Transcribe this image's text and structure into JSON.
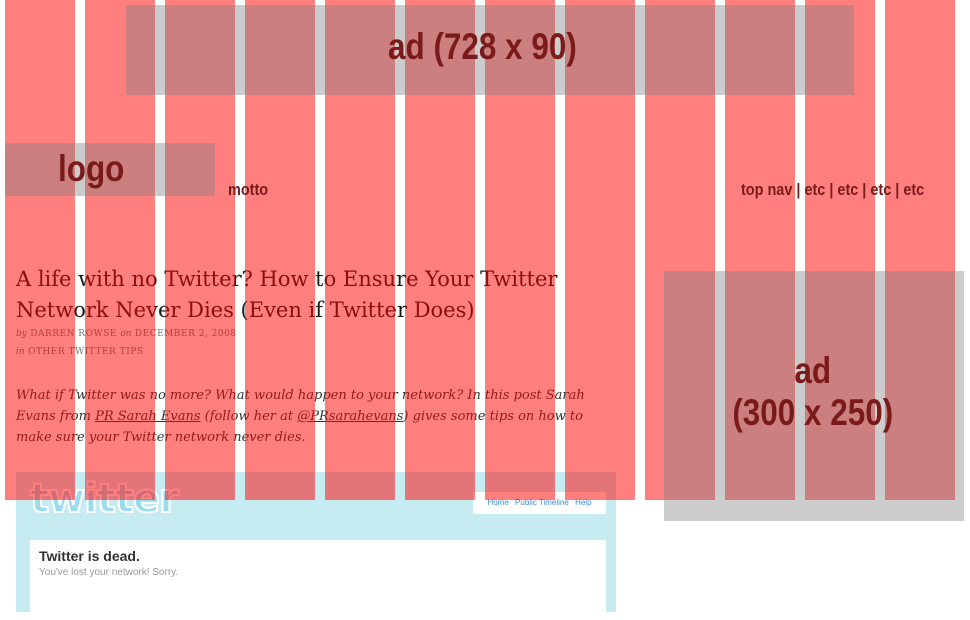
{
  "wireframe": {
    "top_ad_label": "ad (728 x 90)",
    "logo_label": "logo",
    "motto_label": "motto",
    "top_nav_label": "top nav | etc | etc | etc | etc",
    "side_ad_label": "ad\n(300 x 250)",
    "column_color": "#ff0000",
    "box_color": "#808080"
  },
  "post": {
    "title": "A life with no Twitter? How to Ensure Your Twitter Network Never Dies (Even if Twitter Does)",
    "by_prefix": "by",
    "author": "Darren Rowse",
    "on_prefix": "on",
    "date": "December 2, 2008",
    "in_prefix": "in",
    "category": "Other Twitter Tips",
    "excerpt_part1": "What if Twitter was no more? What would happen to your network? In this post Sarah Evans from ",
    "excerpt_link1": "PR Sarah Evans",
    "excerpt_part2": " (follow her at ",
    "excerpt_link2": "@PRsarahevans",
    "excerpt_part3": ") gives some tips on how to make sure your Twitter network never dies."
  },
  "twitter_screenshot": {
    "logo_text": "twitter",
    "nav": [
      "Home",
      "Public Timeline",
      "Help"
    ],
    "headline": "Twitter is dead.",
    "subtext": "You've lost your network! Sorry."
  }
}
